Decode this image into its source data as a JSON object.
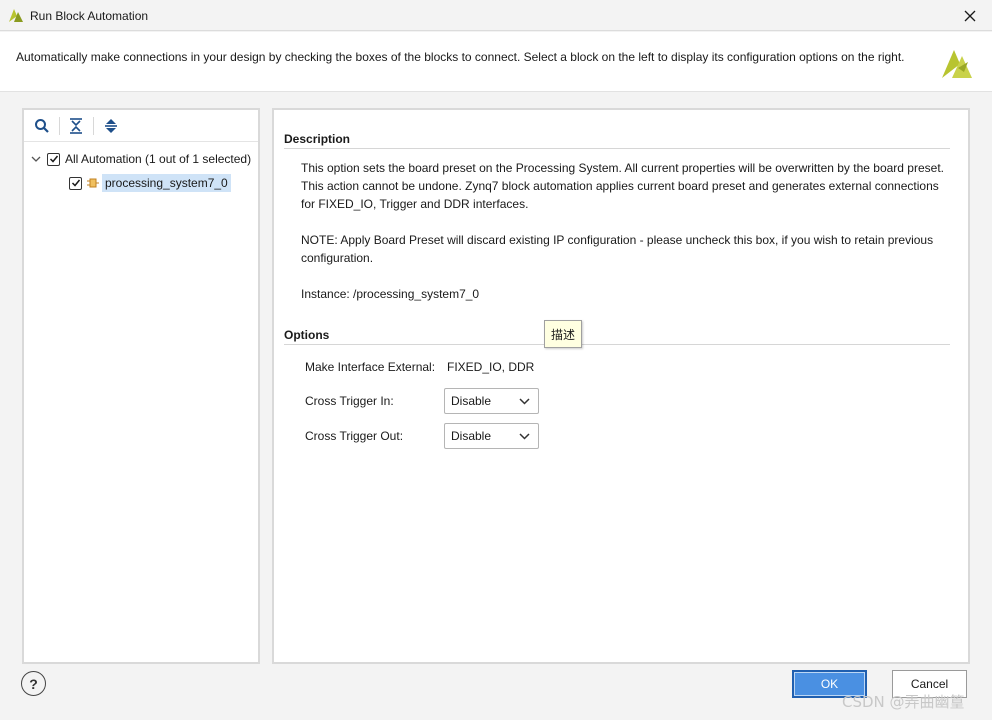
{
  "window": {
    "title": "Run Block Automation"
  },
  "header": {
    "instructions": "Automatically make connections in your design by checking the boxes of the blocks to connect. Select a block on the left to display its configuration options on the right."
  },
  "tree": {
    "root_label": "All Automation (1 out of 1 selected)",
    "root_checked": true,
    "child_label": "processing_system7_0",
    "child_checked": true
  },
  "description": {
    "title": "Description",
    "paragraph1": "This option sets the board preset on the Processing System. All current properties will be overwritten by the board preset. This action cannot be undone. Zynq7 block automation applies current board preset and generates external connections for FIXED_IO, Trigger and DDR interfaces.",
    "paragraph2": "NOTE: Apply Board Preset will discard existing IP configuration - please uncheck this box, if you wish to retain previous configuration.",
    "instance": "Instance: /processing_system7_0"
  },
  "options": {
    "title": "Options",
    "make_interface_label": "Make Interface External:",
    "make_interface_value": "FIXED_IO, DDR",
    "cross_trigger_in_label": "Cross Trigger In:",
    "cross_trigger_in_value": "Disable",
    "cross_trigger_out_label": "Cross Trigger Out:",
    "cross_trigger_out_value": "Disable"
  },
  "tooltip": {
    "text": "描述"
  },
  "footer": {
    "help_label": "?",
    "ok_label": "OK",
    "cancel_label": "Cancel",
    "watermark": "CSDN @弄曲幽篁"
  },
  "colors": {
    "accent": "#4a90e2",
    "selection": "#cfe3f7",
    "brand": "#b8c430"
  }
}
